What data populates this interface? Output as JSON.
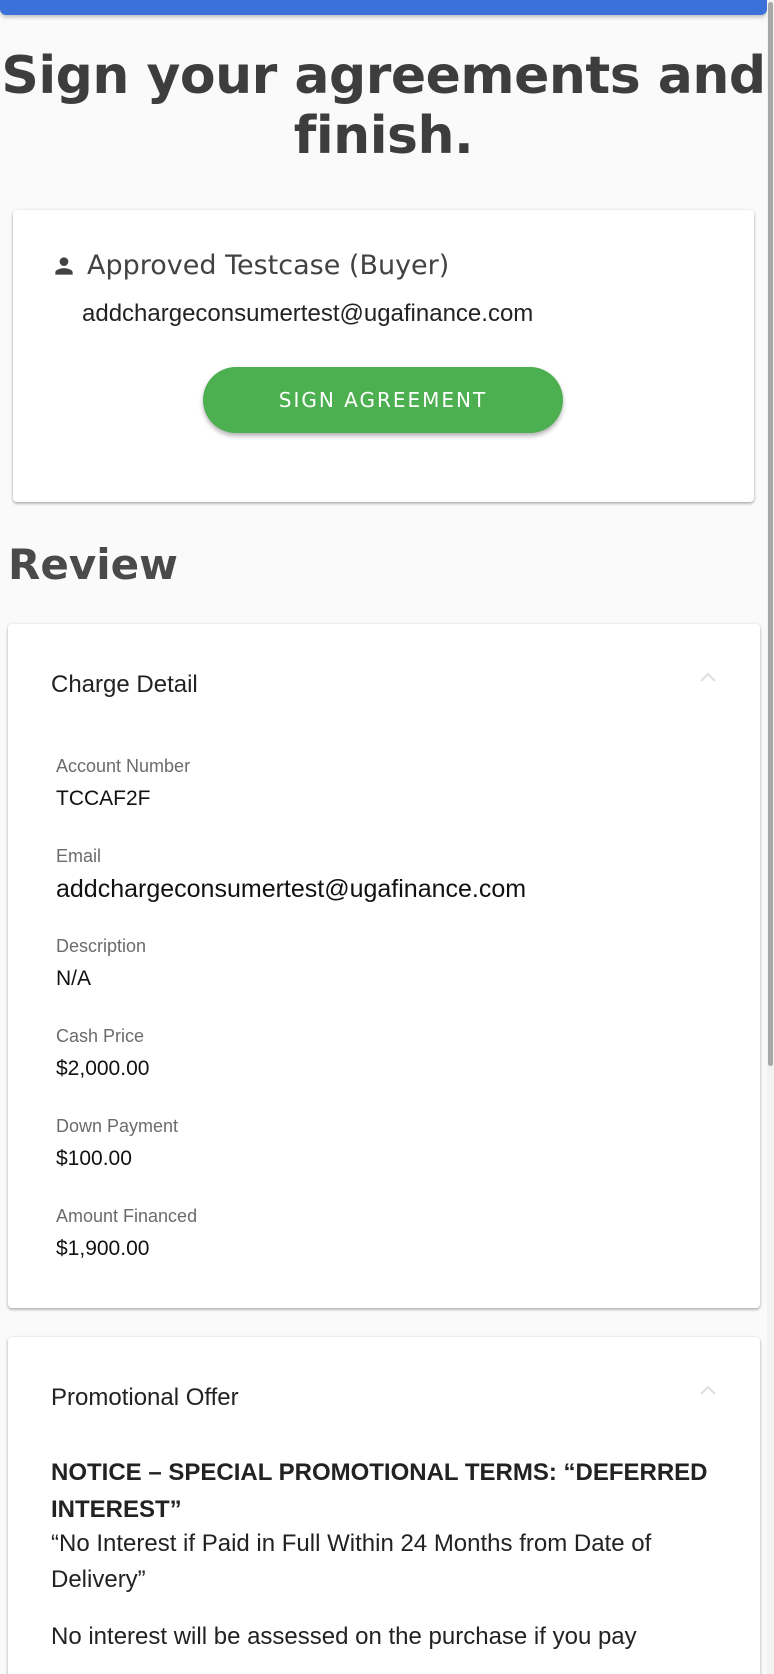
{
  "page": {
    "title": "Sign your agreements and finish.",
    "accent_color": "#3a72d9"
  },
  "signer": {
    "icon": "person-icon",
    "name": "Approved Testcase (Buyer)",
    "email": "addchargeconsumertest@ugafinance.com",
    "sign_button_label": "SIGN AGREEMENT",
    "button_color": "#4caf50"
  },
  "review": {
    "heading": "Review"
  },
  "charge_detail": {
    "title": "Charge Detail",
    "fields": [
      {
        "label": "Account Number",
        "value": "TCCAF2F"
      },
      {
        "label": "Email",
        "value": "addchargeconsumertest@ugafinance.com"
      },
      {
        "label": "Description",
        "value": "N/A"
      },
      {
        "label": "Cash Price",
        "value": "$2,000.00"
      },
      {
        "label": "Down Payment",
        "value": "$100.00"
      },
      {
        "label": "Amount Financed",
        "value": "$1,900.00"
      }
    ]
  },
  "promotional_offer": {
    "title": "Promotional Offer",
    "notice": "NOTICE – SPECIAL PROMOTIONAL TERMS: “DEFERRED INTEREST”",
    "subtitle": "“No Interest if Paid in Full Within 24 Months from Date of Delivery”",
    "body": "No interest will be assessed on the purchase if you pay"
  }
}
